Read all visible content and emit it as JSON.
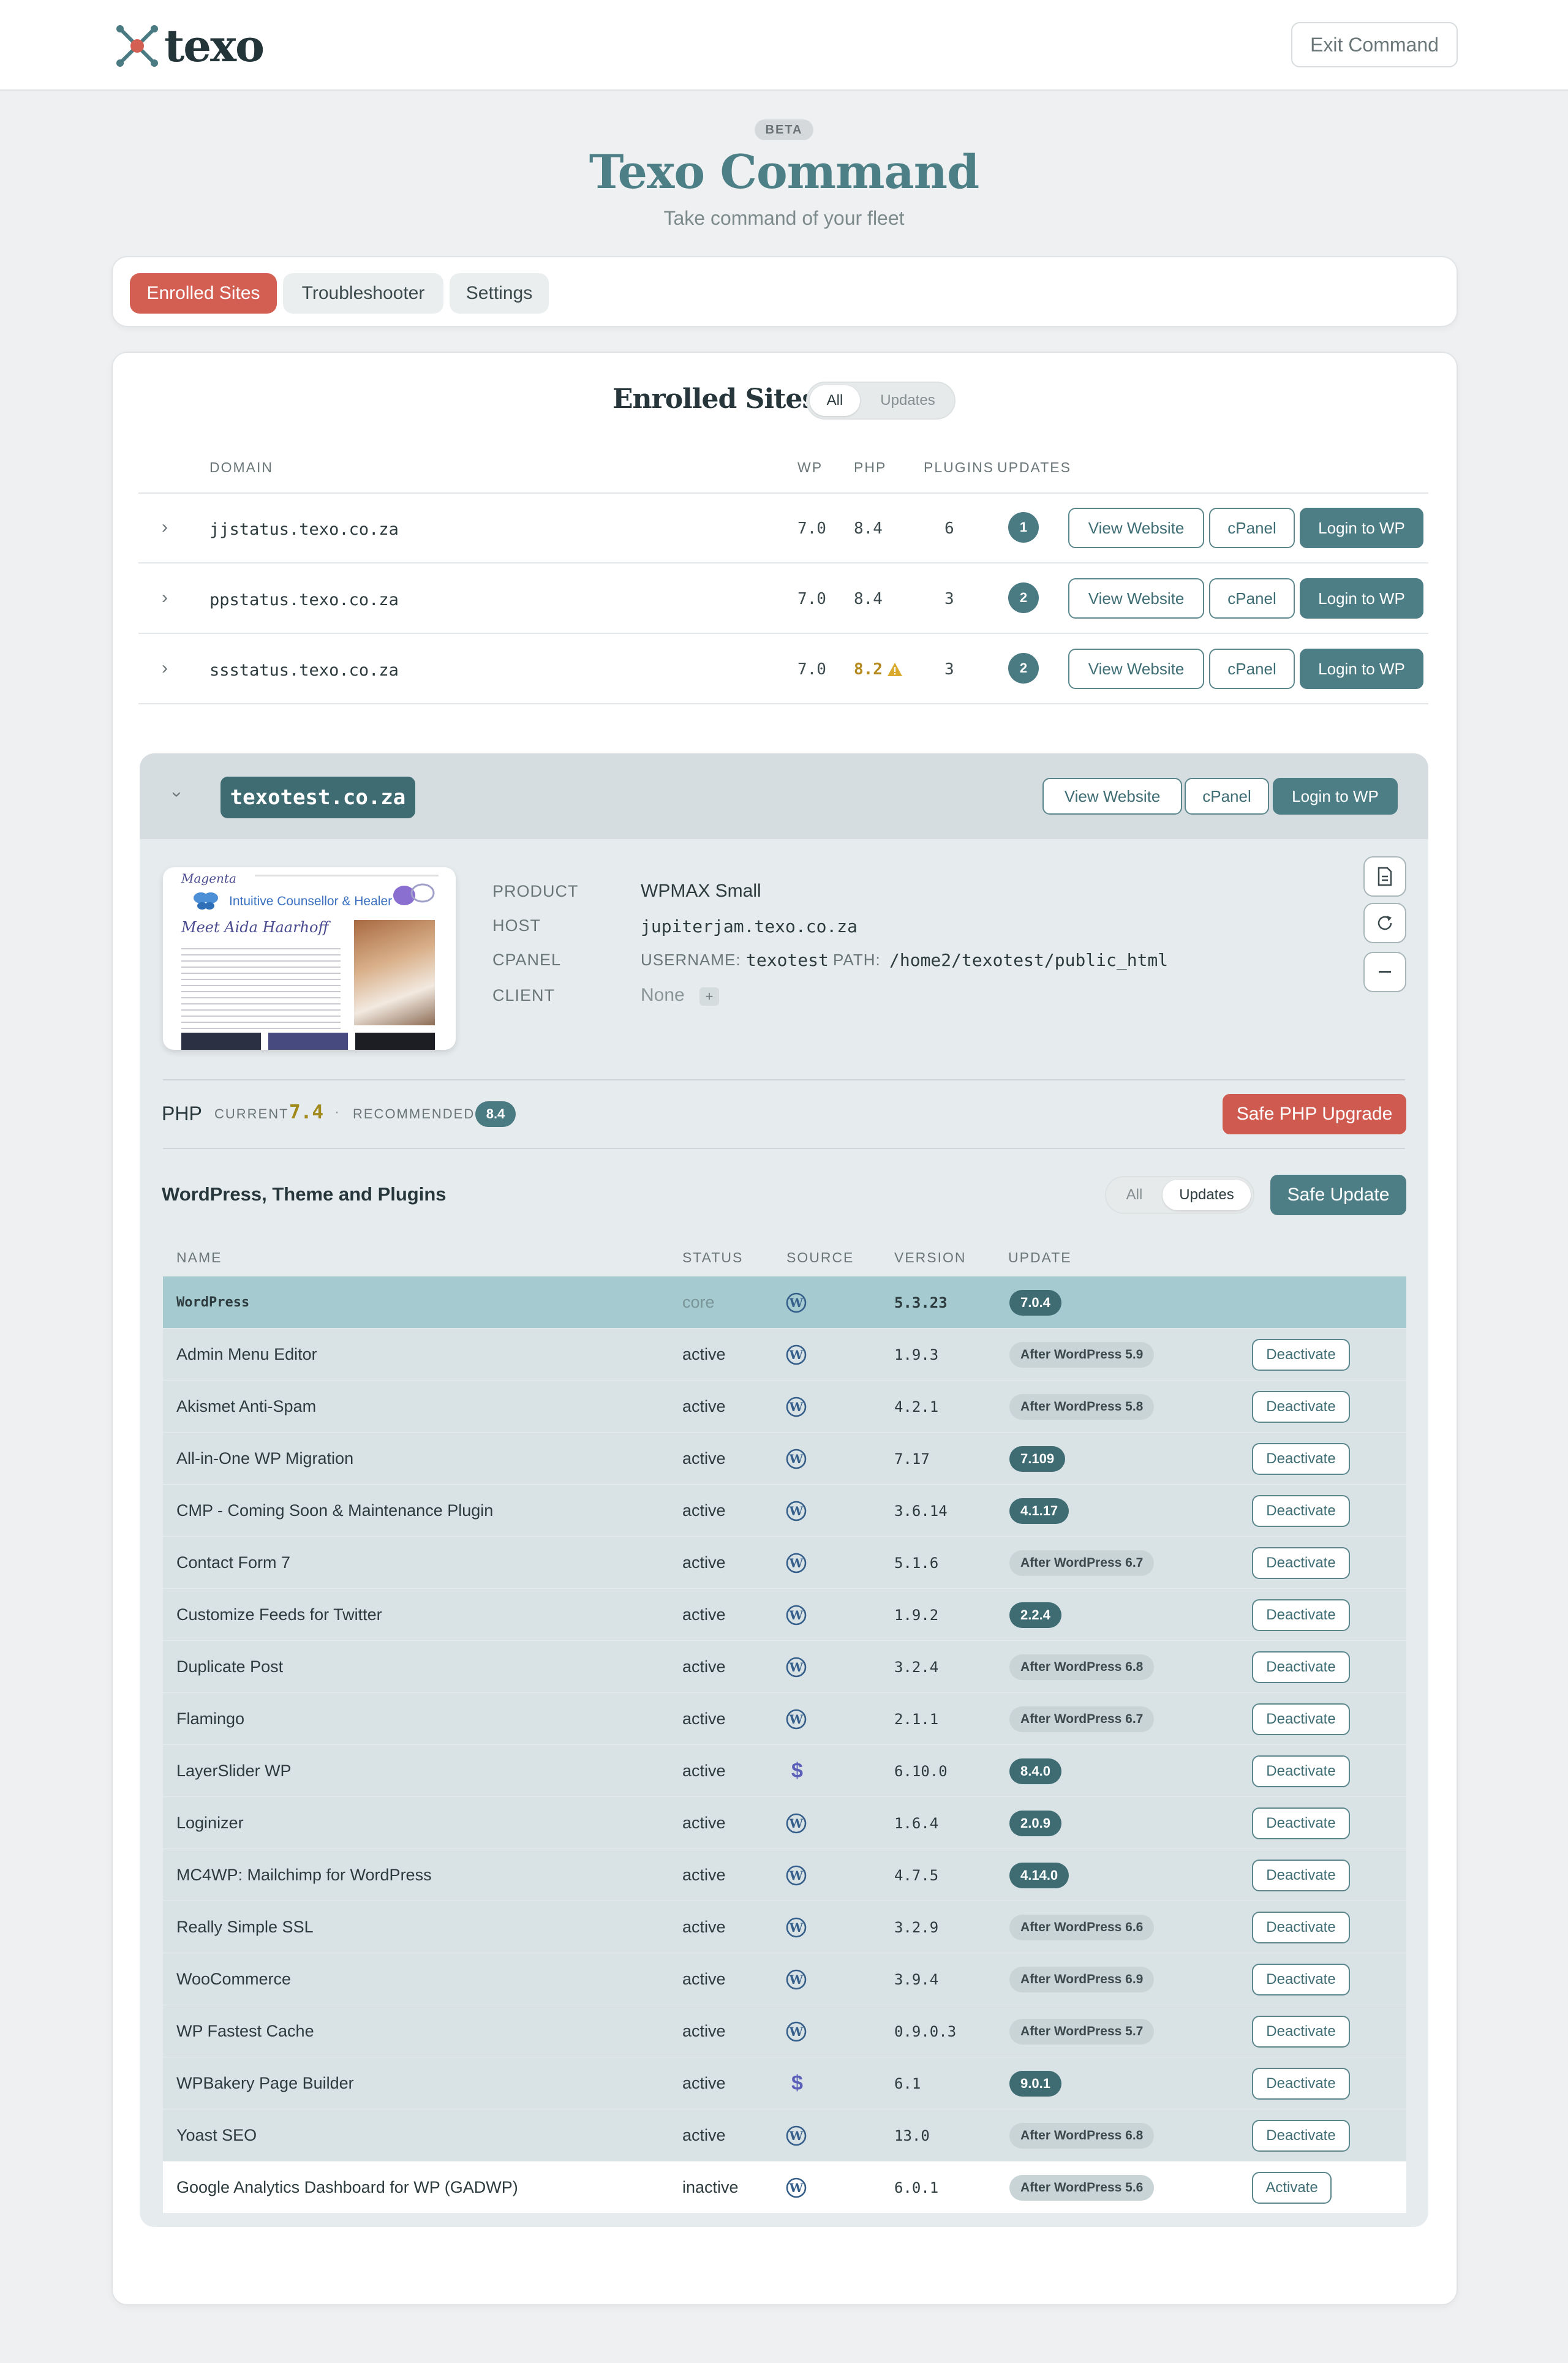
{
  "app": {
    "logo_text": "texo",
    "exit_label": "Exit Command",
    "beta_label": "BETA",
    "title": "Texo Command",
    "subtitle": "Take command of your fleet"
  },
  "tabs": [
    {
      "label": "Enrolled Sites",
      "active": true
    },
    {
      "label": "Troubleshooter",
      "active": false
    },
    {
      "label": "Settings",
      "active": false
    }
  ],
  "enrolled": {
    "title": "Enrolled Sites",
    "filter": {
      "all": "All",
      "updates": "Updates",
      "selected": "All"
    },
    "columns": {
      "domain": "DOMAIN",
      "wp": "WP",
      "php": "PHP",
      "plugins": "PLUGINS",
      "updates": "UPDATES"
    },
    "rows": [
      {
        "domain": "jjstatus.texo.co.za",
        "wp": "7.0",
        "php": "8.4",
        "plugins": "6",
        "updates": "1",
        "php_warning": false
      },
      {
        "domain": "ppstatus.texo.co.za",
        "wp": "7.0",
        "php": "8.4",
        "plugins": "3",
        "updates": "2",
        "php_warning": false
      },
      {
        "domain": "ssstatus.texo.co.za",
        "wp": "7.0",
        "php": "8.2",
        "plugins": "3",
        "updates": "2",
        "php_warning": true
      }
    ],
    "actions": {
      "view": "View Website",
      "cpanel": "cPanel",
      "login": "Login to WP"
    }
  },
  "site": {
    "domain": "texotest.co.za",
    "labels": {
      "product": "PRODUCT",
      "host": "HOST",
      "cpanel": "CPANEL",
      "client": "CLIENT",
      "username": "USERNAME:",
      "path": "PATH:"
    },
    "product": "WPMAX Small",
    "host": "jupiterjam.texo.co.za",
    "cpanel_username": "texotest",
    "cpanel_path": "/home2/texotest/public_html",
    "client": "None",
    "add_client": "+",
    "thumb": {
      "brand": "Magenta",
      "tagline": "Intuitive Counsellor & Healer",
      "heading": "Meet Aida Haarhoff"
    },
    "php": {
      "label": "PHP",
      "current_label": "CURRENT",
      "current": "7.4",
      "separator": "·",
      "recommended_label": "RECOMMENDED",
      "recommended": "8.4",
      "upgrade_label": "Safe PHP Upgrade"
    },
    "plugins_section": {
      "title": "WordPress, Theme and Plugins",
      "filter": {
        "all": "All",
        "updates": "Updates",
        "selected": "Updates"
      },
      "safe_update_label": "Safe Update",
      "columns": {
        "name": "NAME",
        "status": "STATUS",
        "source": "SOURCE",
        "version": "VERSION",
        "update": "UPDATE"
      }
    },
    "plugins": [
      {
        "name": "WordPress",
        "status": "core",
        "source": "wordpress-icon",
        "version": "5.3.23",
        "update": "7.0.4",
        "update_kind": "version",
        "action": ""
      },
      {
        "name": "Admin Menu Editor",
        "status": "active",
        "source": "wordpress-icon",
        "version": "1.9.3",
        "update": "After WordPress 5.9",
        "update_kind": "after",
        "action": "Deactivate"
      },
      {
        "name": "Akismet Anti-Spam",
        "status": "active",
        "source": "wordpress-icon",
        "version": "4.2.1",
        "update": "After WordPress 5.8",
        "update_kind": "after",
        "action": "Deactivate"
      },
      {
        "name": "All-in-One WP Migration",
        "status": "active",
        "source": "wordpress-icon",
        "version": "7.17",
        "update": "7.109",
        "update_kind": "version",
        "action": "Deactivate"
      },
      {
        "name": "CMP - Coming Soon & Maintenance Plugin",
        "status": "active",
        "source": "wordpress-icon",
        "version": "3.6.14",
        "update": "4.1.17",
        "update_kind": "version",
        "action": "Deactivate"
      },
      {
        "name": "Contact Form 7",
        "status": "active",
        "source": "wordpress-icon",
        "version": "5.1.6",
        "update": "After WordPress 6.7",
        "update_kind": "after",
        "action": "Deactivate"
      },
      {
        "name": "Customize Feeds for Twitter",
        "status": "active",
        "source": "wordpress-icon",
        "version": "1.9.2",
        "update": "2.2.4",
        "update_kind": "version",
        "action": "Deactivate"
      },
      {
        "name": "Duplicate Post",
        "status": "active",
        "source": "wordpress-icon",
        "version": "3.2.4",
        "update": "After WordPress 6.8",
        "update_kind": "after",
        "action": "Deactivate"
      },
      {
        "name": "Flamingo",
        "status": "active",
        "source": "wordpress-icon",
        "version": "2.1.1",
        "update": "After WordPress 6.7",
        "update_kind": "after",
        "action": "Deactivate"
      },
      {
        "name": "LayerSlider WP",
        "status": "active",
        "source": "dollar-icon",
        "version": "6.10.0",
        "update": "8.4.0",
        "update_kind": "version",
        "action": "Deactivate"
      },
      {
        "name": "Loginizer",
        "status": "active",
        "source": "wordpress-icon",
        "version": "1.6.4",
        "update": "2.0.9",
        "update_kind": "version",
        "action": "Deactivate"
      },
      {
        "name": "MC4WP: Mailchimp for WordPress",
        "status": "active",
        "source": "wordpress-icon",
        "version": "4.7.5",
        "update": "4.14.0",
        "update_kind": "version",
        "action": "Deactivate"
      },
      {
        "name": "Really Simple SSL",
        "status": "active",
        "source": "wordpress-icon",
        "version": "3.2.9",
        "update": "After WordPress 6.6",
        "update_kind": "after",
        "action": "Deactivate"
      },
      {
        "name": "WooCommerce",
        "status": "active",
        "source": "wordpress-icon",
        "version": "3.9.4",
        "update": "After WordPress 6.9",
        "update_kind": "after",
        "action": "Deactivate"
      },
      {
        "name": "WP Fastest Cache",
        "status": "active",
        "source": "wordpress-icon",
        "version": "0.9.0.3",
        "update": "After WordPress 5.7",
        "update_kind": "after",
        "action": "Deactivate"
      },
      {
        "name": "WPBakery Page Builder",
        "status": "active",
        "source": "dollar-icon",
        "version": "6.1",
        "update": "9.0.1",
        "update_kind": "version",
        "action": "Deactivate"
      },
      {
        "name": "Yoast SEO",
        "status": "active",
        "source": "wordpress-icon",
        "version": "13.0",
        "update": "After WordPress 6.8",
        "update_kind": "after",
        "action": "Deactivate"
      },
      {
        "name": "Google Analytics Dashboard for WP (GADWP)",
        "status": "inactive",
        "source": "wordpress-icon",
        "version": "6.0.1",
        "update": "After WordPress 5.6",
        "update_kind": "after",
        "action": "Activate"
      }
    ]
  },
  "colors": {
    "accent": "#4e7e85",
    "danger": "#cf5a4f",
    "warning": "#b48a1d",
    "brand_red": "#d35e52"
  }
}
